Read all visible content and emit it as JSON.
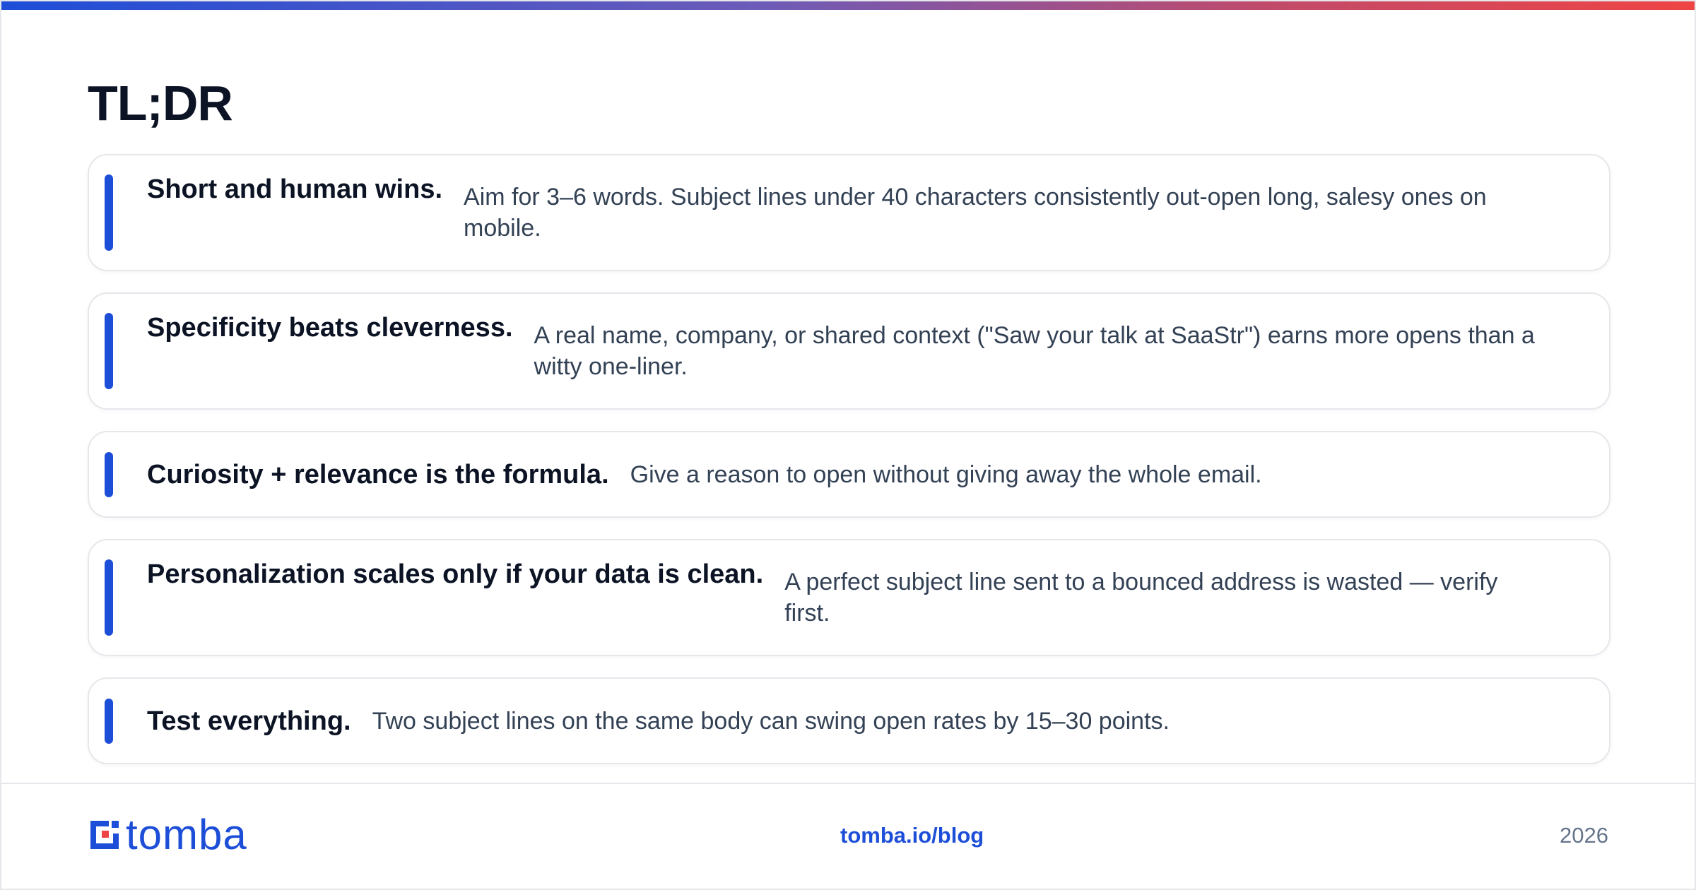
{
  "title": "TL;DR",
  "accent_color": "#1d4ed8",
  "items": [
    {
      "heading": "Short and human wins.",
      "description": "Aim for 3–6 words. Subject lines under 40 characters consistently out-open long, salesy ones on mobile."
    },
    {
      "heading": "Specificity beats cleverness.",
      "description": "A real name, company, or shared context (\"Saw your talk at SaaStr\") earns more opens than a witty one-liner."
    },
    {
      "heading": "Curiosity + relevance is the formula.",
      "description": "Give a reason to open without giving away the whole email."
    },
    {
      "heading": "Personalization scales only if your data is clean.",
      "description": "A perfect subject line sent to a bounced address is wasted — verify first."
    },
    {
      "heading": "Test everything.",
      "description": "Two subject lines on the same body can swing open rates by 15–30 points."
    }
  ],
  "footer": {
    "logo_text": "tomba",
    "logo_icon": "tomba-logo-icon",
    "link": "tomba.io/blog",
    "year": "2026"
  }
}
